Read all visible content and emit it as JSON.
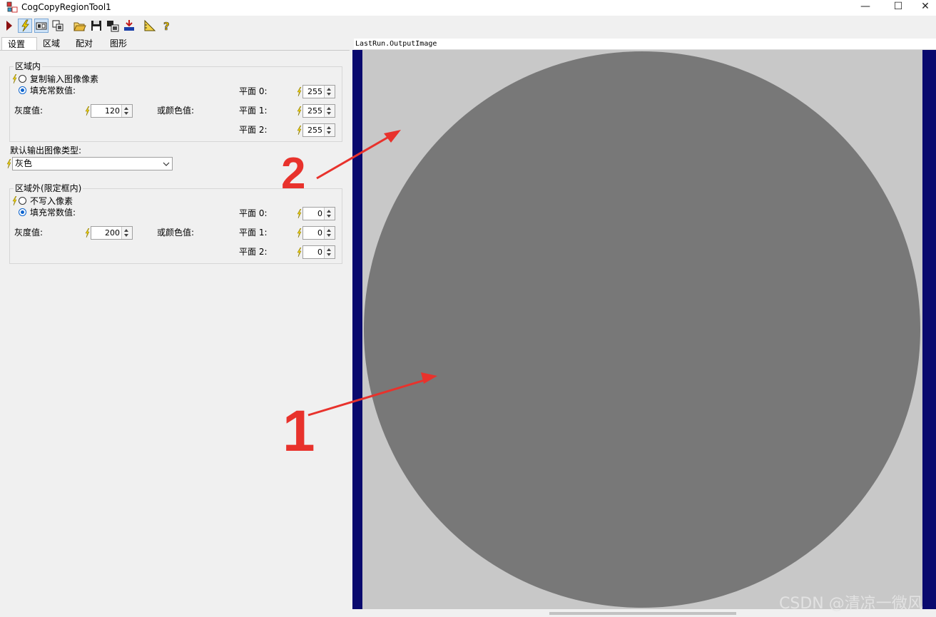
{
  "window": {
    "title": "CogCopyRegionTool1",
    "controls": {
      "minimize": "—",
      "maximize": "☐",
      "close": "✕"
    }
  },
  "toolbar": {
    "buttons": [
      "run-icon",
      "electric-icon",
      "region-display-icon",
      "copy-icon",
      "open-icon",
      "save-icon",
      "image-source-icon",
      "reset-icon",
      "ruler-icon",
      "help-icon"
    ]
  },
  "tabs": [
    "设置",
    "区域",
    "配对",
    "图形"
  ],
  "inside": {
    "legend": "区域内",
    "copy_input": "复制输入图像像素",
    "fill_const": "填充常数值:",
    "gray_label": "灰度值:",
    "gray_value": "120",
    "color_label": "或颜色值:",
    "planes": [
      {
        "label": "平面 0:",
        "value": "255"
      },
      {
        "label": "平面 1:",
        "value": "255"
      },
      {
        "label": "平面 2:",
        "value": "255"
      }
    ]
  },
  "output_type": {
    "label": "默认输出图像类型:",
    "value": "灰色"
  },
  "outside": {
    "legend": "区域外(限定框内)",
    "no_write": "不写入像素",
    "fill_const": "填充常数值:",
    "gray_label": "灰度值:",
    "gray_value": "200",
    "color_label": "或颜色值:",
    "planes": [
      {
        "label": "平面 0:",
        "value": "0"
      },
      {
        "label": "平面 1:",
        "value": "0"
      },
      {
        "label": "平面 2:",
        "value": "0"
      }
    ]
  },
  "image": {
    "caption": "LastRun.OutputImage",
    "colors": {
      "border": "#0a0a6e",
      "background": "#c8c8c8",
      "circle": "#787878"
    }
  },
  "annotations": {
    "mark1": "1",
    "mark2": "2",
    "color": "#e8322c"
  },
  "watermark": "CSDN @清凉一微风"
}
